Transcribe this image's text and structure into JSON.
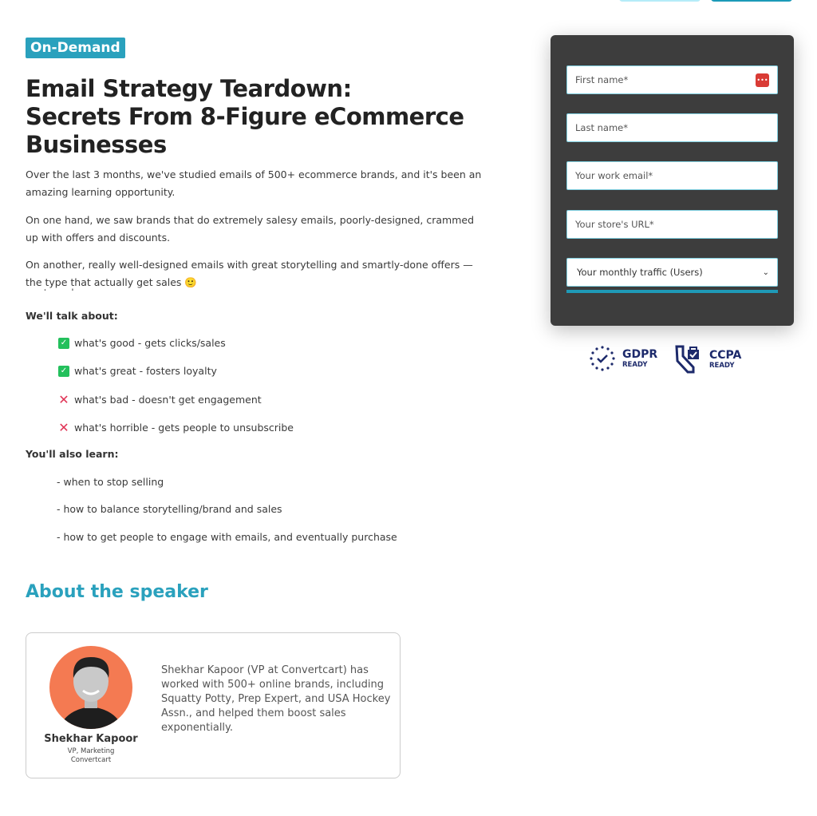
{
  "badge": "On-Demand",
  "title_lines": [
    "Email Strategy Teardown:",
    "Secrets From 8-Figure eCommerce",
    "Businesses"
  ],
  "paragraphs": [
    "Over the last 3 months, we've studied emails of 500+ ecommerce brands, and it's been an amazing learning opportunity.",
    "On one hand, we saw brands that do extremely salesy emails, poorly-designed, crammed up with offers and discounts.",
    "On another, really well-designed emails with great storytelling and smartly-done offers — the type that actually get sales 🙂"
  ],
  "overlap_text": "next week.",
  "talk_heading": "We'll talk about:",
  "talk_items": [
    {
      "text": "what's good - gets clicks/sales",
      "icon": "check"
    },
    {
      "text": "what's great - fosters loyalty",
      "icon": "check"
    },
    {
      "text": "what's bad - doesn't get engagement",
      "icon": "cross"
    },
    {
      "text": "what's horrible - gets people to unsubscribe",
      "icon": "cross"
    }
  ],
  "learn_heading": "You'll also learn:",
  "learn_items": [
    "- when to stop selling",
    "- how to balance storytelling/brand and sales",
    "- how to get people to engage with emails, and eventually purchase"
  ],
  "speaker_heading": "About the speaker",
  "speaker": {
    "name": "Shekhar Kapoor",
    "role": "VP, Marketing",
    "company": "Convertcart",
    "bio": "Shekhar Kapoor (VP at Convertcart) has worked with 500+ online brands, including Squatty Potty, Prep Expert, and USA Hockey Assn., and helped them boost sales exponentially."
  },
  "form": {
    "first_name": "First name*",
    "last_name": "Last name*",
    "email": "Your work email*",
    "url": "Your store's URL*",
    "traffic": "Your monthly traffic (Users)"
  },
  "compliance": [
    {
      "name": "GDPR",
      "label": "READY"
    },
    {
      "name": "CCPA",
      "label": "READY"
    }
  ],
  "colors": {
    "accent": "#2aa1bd",
    "form_bg": "#3d3d3d",
    "avatar_bg": "#f47a52",
    "check": "#23c05c",
    "cross": "#e03355"
  }
}
